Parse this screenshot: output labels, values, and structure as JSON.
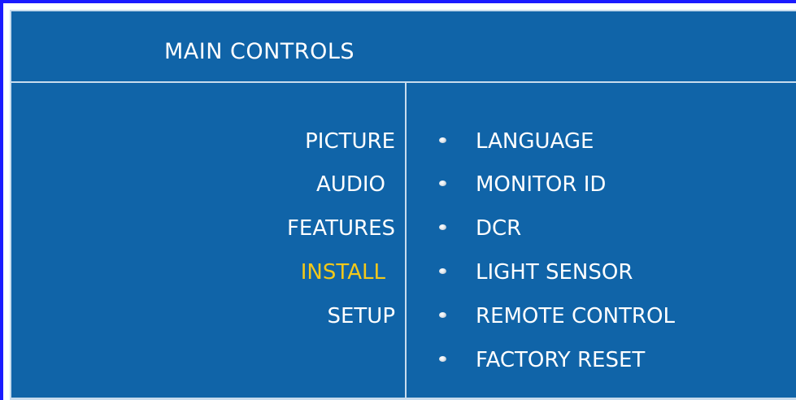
{
  "header": {
    "title": "MAIN CONTROLS"
  },
  "main_menu": {
    "items": [
      {
        "label": "PICTURE",
        "active": false
      },
      {
        "label": "AUDIO",
        "active": false
      },
      {
        "label": "FEATURES",
        "active": false
      },
      {
        "label": "INSTALL",
        "active": true
      },
      {
        "label": "SETUP",
        "active": false
      }
    ]
  },
  "submenu": {
    "items": [
      {
        "label": "LANGUAGE"
      },
      {
        "label": "MONITOR ID"
      },
      {
        "label": "DCR"
      },
      {
        "label": "LIGHT SENSOR"
      },
      {
        "label": "REMOTE CONTROL"
      },
      {
        "label": "FACTORY RESET"
      }
    ]
  },
  "colors": {
    "panel_background": "#1064a8",
    "frame_border": "#1a1aff",
    "divider": "#c8dcee",
    "text": "#ffffff",
    "active_text": "#f2c81a"
  }
}
